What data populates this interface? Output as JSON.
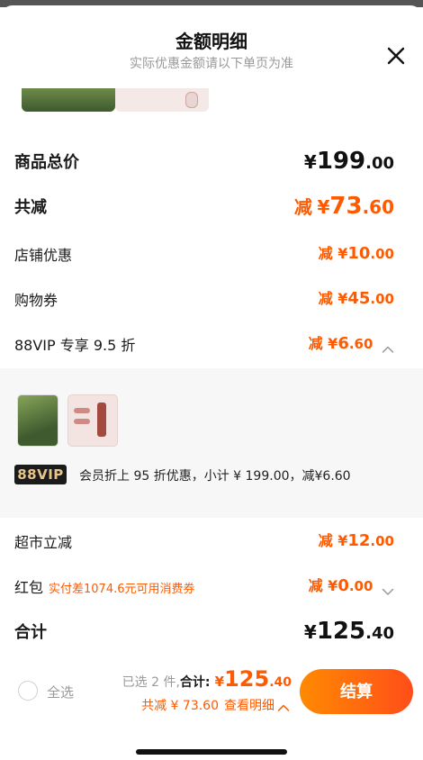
{
  "sheet": {
    "title": "金额明细",
    "subtitle": "实际优惠金额请以下单页为准"
  },
  "rows": {
    "total_goods": {
      "label": "商品总价",
      "cur": "¥",
      "int": "199",
      "dec": ".00"
    },
    "total_reduce": {
      "label": "共减",
      "pre": "减",
      "cur": "¥",
      "int": "73",
      "dec": ".60"
    },
    "store_discount": {
      "label": "店铺优惠",
      "pre": "减",
      "cur": "¥",
      "int": "10",
      "dec": ".00"
    },
    "coupon": {
      "label": "购物券",
      "pre": "减",
      "cur": "¥",
      "int": "45",
      "dec": ".00"
    },
    "vip": {
      "label": "88VIP 专享 9.5 折",
      "pre": "减",
      "cur": "¥",
      "int": "6",
      "dec": ".60"
    },
    "market": {
      "label": "超市立减",
      "pre": "减",
      "cur": "¥",
      "int": "12",
      "dec": ".00"
    },
    "hongbao": {
      "label": "红包",
      "hint": "实付差1074.6元可用消费券",
      "pre": "减",
      "cur": "¥",
      "int": "0",
      "dec": ".00"
    },
    "sum": {
      "label": "合计",
      "cur": "¥",
      "int": "125",
      "dec": ".40"
    }
  },
  "vip_panel": {
    "badge": "88VIP",
    "description": "会员折上 95 折优惠，小计 ¥ 199.00，减¥6.60"
  },
  "bottom_bar": {
    "select_all": "全选",
    "selected_text": "已选 2 件,",
    "total_label": "合计:",
    "cur": "¥",
    "int": "125",
    "dec": ".40",
    "reduce_text": "共减 ¥ 73.60",
    "detail_link": "查看明细",
    "checkout": "结算"
  },
  "colors": {
    "accent": "#ff5a00",
    "checkout_start": "#ff8a00",
    "checkout_end": "#ff4e1a"
  },
  "icons": [
    "close-icon",
    "chevron-up-icon",
    "chevron-down-icon"
  ]
}
